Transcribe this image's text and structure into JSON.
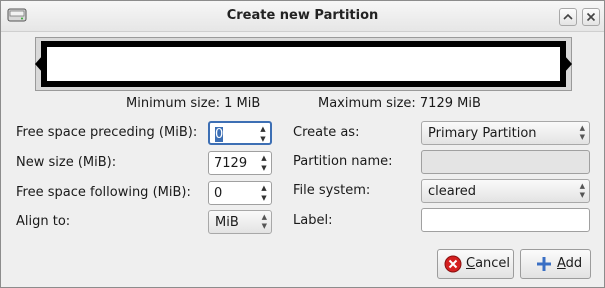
{
  "window": {
    "title": "Create new Partition",
    "icons": [
      "disk-icon",
      "maximize-icon",
      "close-icon"
    ]
  },
  "sizes": {
    "minimum": "Minimum size: 1 MiB",
    "maximum": "Maximum size: 7129 MiB"
  },
  "left_form": {
    "preceding_label": "Free space preceding (MiB):",
    "preceding_value": "0",
    "new_size_label": "New size (MiB):",
    "new_size_value": "7129",
    "following_label": "Free space following (MiB):",
    "following_value": "0",
    "align_label": "Align to:",
    "align_value": "MiB"
  },
  "right_form": {
    "create_as_label": "Create as:",
    "create_as_value": "Primary Partition",
    "partition_name_label": "Partition name:",
    "partition_name_value": "",
    "filesystem_label": "File system:",
    "filesystem_value": "cleared",
    "label_label": "Label:",
    "label_value": ""
  },
  "buttons": {
    "cancel_mnemonic": "C",
    "cancel_rest": "ancel",
    "add_mnemonic": "A",
    "add_rest": "dd"
  },
  "colors": {
    "focus": "#3d6fb4",
    "cancel_icon": "#d42020",
    "add_icon": "#3a6fc4"
  }
}
